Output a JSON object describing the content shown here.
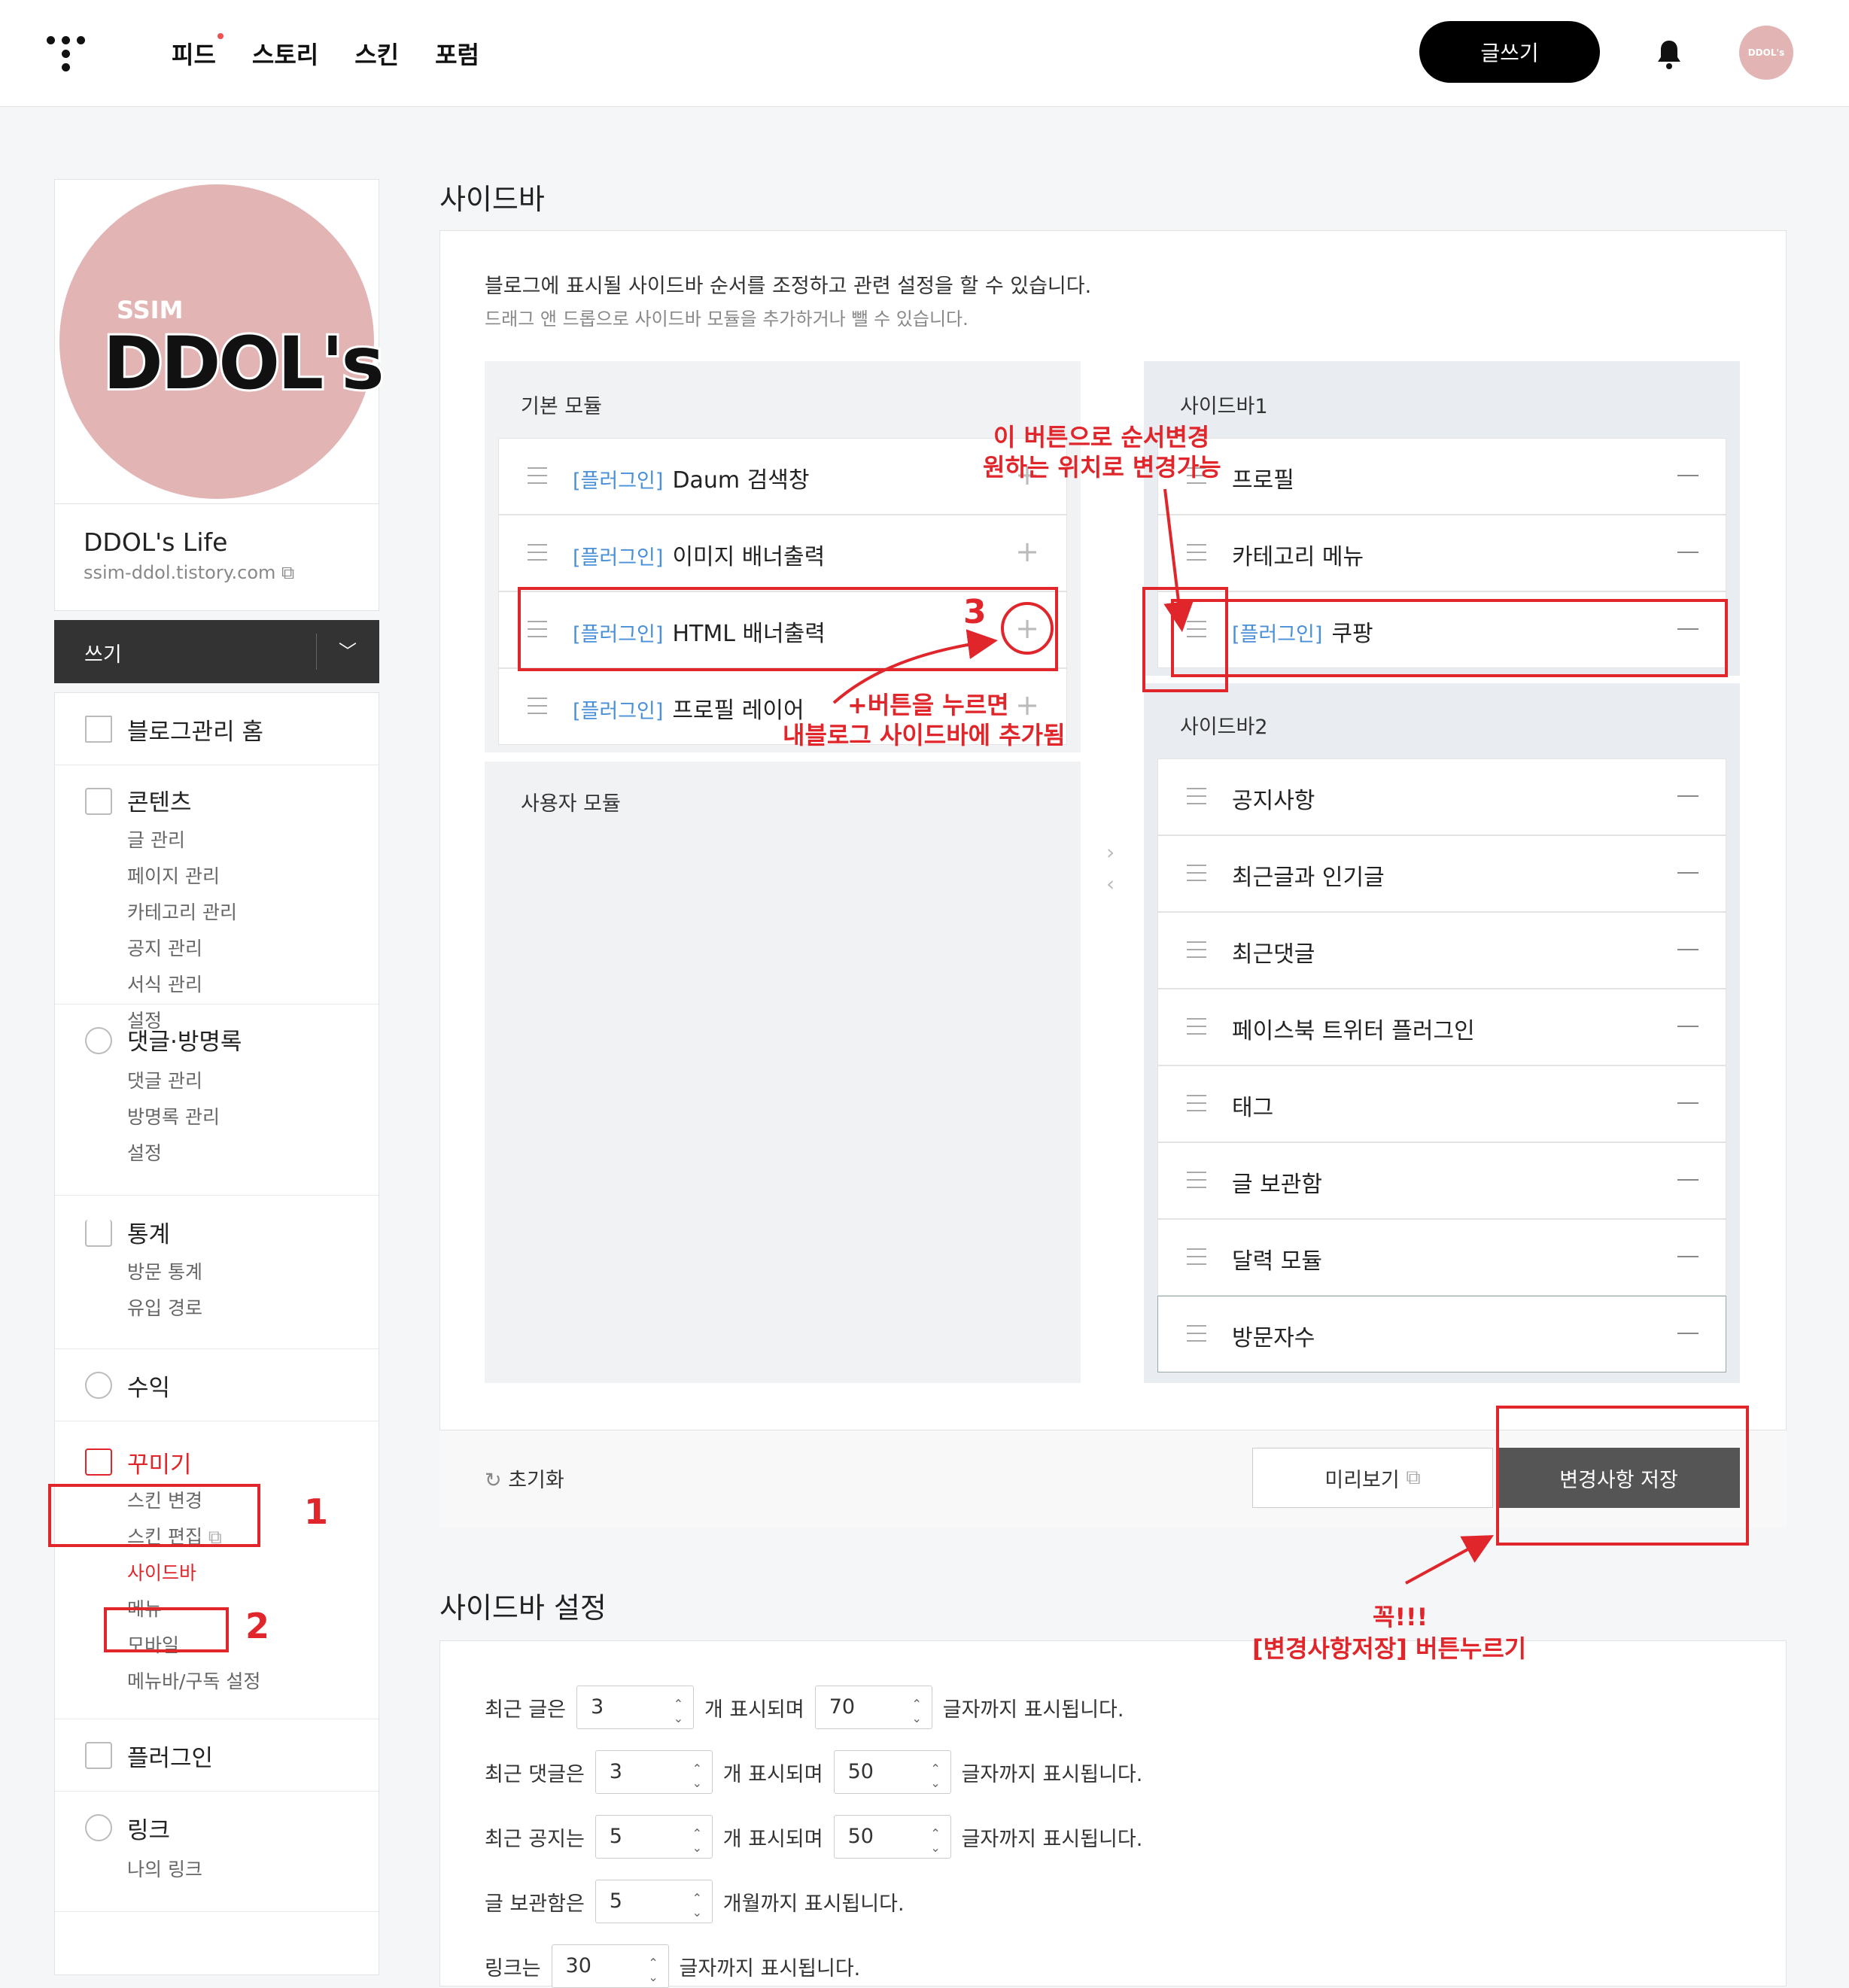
{
  "topbar": {
    "nav": [
      "피드",
      "스토리",
      "스킨",
      "포럼"
    ],
    "write_label": "글쓰기",
    "avatar_text": "DDOL's",
    "bell_icon": "bell-icon"
  },
  "profile": {
    "image_small": "SSIM",
    "image_big": "DDOL's",
    "title": "DDOL's Life",
    "url": "ssim-ddol.tistory.com"
  },
  "write_bar": {
    "label": "쓰기"
  },
  "menu": {
    "home": "블로그관리 홈",
    "contents": {
      "head": "콘텐츠",
      "items": [
        "글 관리",
        "페이지 관리",
        "카테고리 관리",
        "공지 관리",
        "서식 관리",
        "설정"
      ]
    },
    "comments": {
      "head": "댓글·방명록",
      "items": [
        "댓글 관리",
        "방명록 관리",
        "설정"
      ]
    },
    "stats": {
      "head": "통계",
      "items": [
        "방문 통계",
        "유입 경로"
      ]
    },
    "revenue": {
      "head": "수익"
    },
    "decorate": {
      "head": "꾸미기",
      "items": [
        "스킨 변경",
        "스킨 편집",
        "사이드바",
        "메뉴",
        "모바일",
        "메뉴바/구독 설정"
      ]
    },
    "plugin": {
      "head": "플러그인"
    },
    "link": {
      "head": "링크",
      "items": [
        "나의 링크"
      ]
    }
  },
  "sidebar": {
    "title": "사이드바",
    "desc1": "블로그에 표시될 사이드바 순서를 조정하고 관련 설정을 할 수 있습니다.",
    "desc2": "드래그 앤 드롭으로 사이드바 모듈을 추가하거나 뺄 수 있습니다.",
    "basic_label": "기본 모듈",
    "user_label": "사용자 모듈",
    "plugin_tag": "[플러그인]",
    "basic_modules": [
      "Daum 검색창",
      "이미지 배너출력",
      "HTML 배너출력",
      "프로필 레이어"
    ],
    "sidebar1_label": "사이드바1",
    "sidebar1": [
      "프로필",
      "카테고리 메뉴",
      "쿠팡"
    ],
    "sidebar2_label": "사이드바2",
    "sidebar2": [
      "공지사항",
      "최근글과 인기글",
      "최근댓글",
      "페이스북 트위터 플러그인",
      "태그",
      "글 보관함",
      "달력 모듈",
      "방문자수"
    ],
    "reset": "초기화",
    "preview": "미리보기",
    "save": "변경사항 저장"
  },
  "settings": {
    "title": "사이드바 설정",
    "rows": [
      {
        "label": "최근 글은",
        "v1": "3",
        "mid": "개 표시되며",
        "v2": "70",
        "end": "글자까지 표시됩니다."
      },
      {
        "label": "최근 댓글은",
        "v1": "3",
        "mid": "개 표시되며",
        "v2": "50",
        "end": "글자까지 표시됩니다."
      },
      {
        "label": "최근 공지는",
        "v1": "5",
        "mid": "개 표시되며",
        "v2": "50",
        "end": "글자까지 표시됩니다."
      },
      {
        "label": "글 보관함은",
        "v1": "5",
        "end": "개월까지 표시됩니다."
      },
      {
        "label": "링크는",
        "v1": "30",
        "end": "글자까지 표시됩니다."
      }
    ]
  },
  "annotations": {
    "n1": "1",
    "n2": "2",
    "n3": "3",
    "order_line1": "이 버튼으로 순서변경",
    "order_line2": "원하는 위치로 변경가능",
    "plus_line1": "+버튼을 누르면",
    "plus_line2": "내블로그 사이드바에 추가됨",
    "save_line1": "꼭!!!",
    "save_line2": "[변경사항저장] 버튼누르기",
    "color": "#e0262b"
  }
}
